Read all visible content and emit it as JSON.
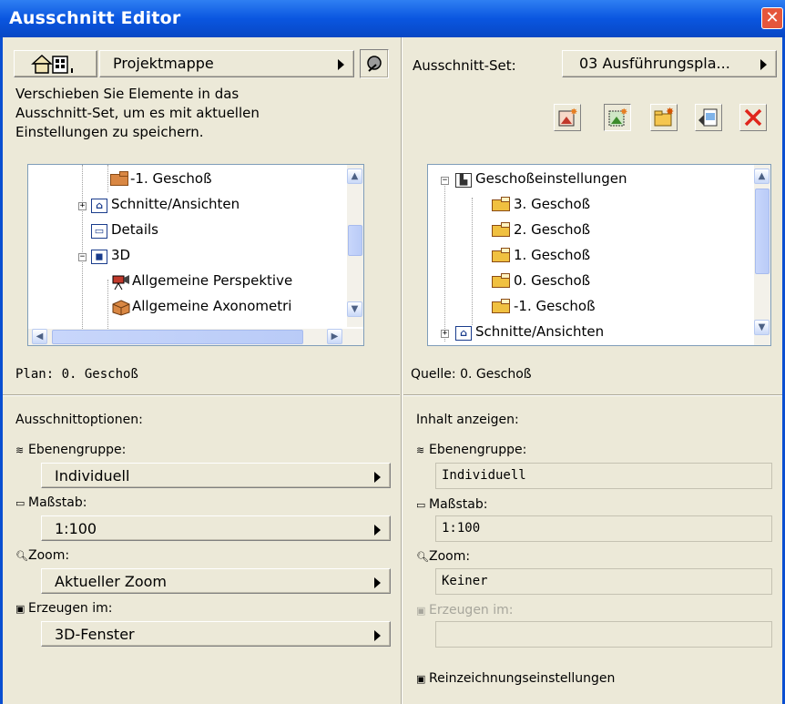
{
  "window": {
    "title": "Ausschnitt Editor"
  },
  "left": {
    "map_popup": "Projektmappe",
    "hint": [
      "Verschieben Sie Elemente in das",
      "Ausschnitt-Set, um es mit aktuellen",
      "Einstellungen zu speichern."
    ],
    "tree": [
      {
        "label": "-1. Geschoß",
        "icon": "story-folder-icon"
      },
      {
        "label": "Schnitte/Ansichten",
        "icon": "section-folder-icon"
      },
      {
        "label": "Details",
        "icon": "details-icon"
      },
      {
        "label": "3D",
        "icon": "3d-folder-icon"
      },
      {
        "label": "Allgemeine Perspektive",
        "icon": "camera-icon"
      },
      {
        "label": "Allgemeine Axonometri",
        "icon": "axonometry-icon"
      }
    ],
    "status": "Plan: 0. Geschoß",
    "options_heading": "Ausschnittoptionen:",
    "layer_label": "Ebenengruppe:",
    "layer_value": "Individuell",
    "scale_label": "Maßstab:",
    "scale_value": "1:100",
    "zoom_label": "Zoom:",
    "zoom_value": "Aktueller Zoom",
    "create_label": "Erzeugen im:",
    "create_value": "3D-Fenster"
  },
  "right": {
    "set_label": "Ausschnitt-Set:",
    "set_value": "03 Ausführungspla...",
    "tree": [
      {
        "label": "Geschoßeinstellungen",
        "icon": "story-settings-icon"
      },
      {
        "label": "3. Geschoß",
        "icon": "story-folder-icon"
      },
      {
        "label": "2. Geschoß",
        "icon": "story-folder-icon"
      },
      {
        "label": "1. Geschoß",
        "icon": "story-folder-icon"
      },
      {
        "label": "0. Geschoß",
        "icon": "story-folder-icon"
      },
      {
        "label": "-1. Geschoß",
        "icon": "story-folder-icon"
      },
      {
        "label": "Schnitte/Ansichten",
        "icon": "section-folder-icon"
      }
    ],
    "status": "Quelle: 0. Geschoß",
    "content_heading": "Inhalt anzeigen:",
    "layer_label": "Ebenengruppe:",
    "layer_value": "Individuell",
    "scale_label": "Maßstab:",
    "scale_value": "1:100",
    "zoom_label": "Zoom:",
    "zoom_value": "Keiner",
    "create_label": "Erzeugen im:",
    "create_value": "",
    "pen_settings": "Reinzeichnungseinstellungen"
  },
  "colors": {
    "titlebar": "#0a56e0",
    "dialog_bg": "#ece9d8",
    "folder": "#d98743",
    "delete": "#e0261b"
  }
}
